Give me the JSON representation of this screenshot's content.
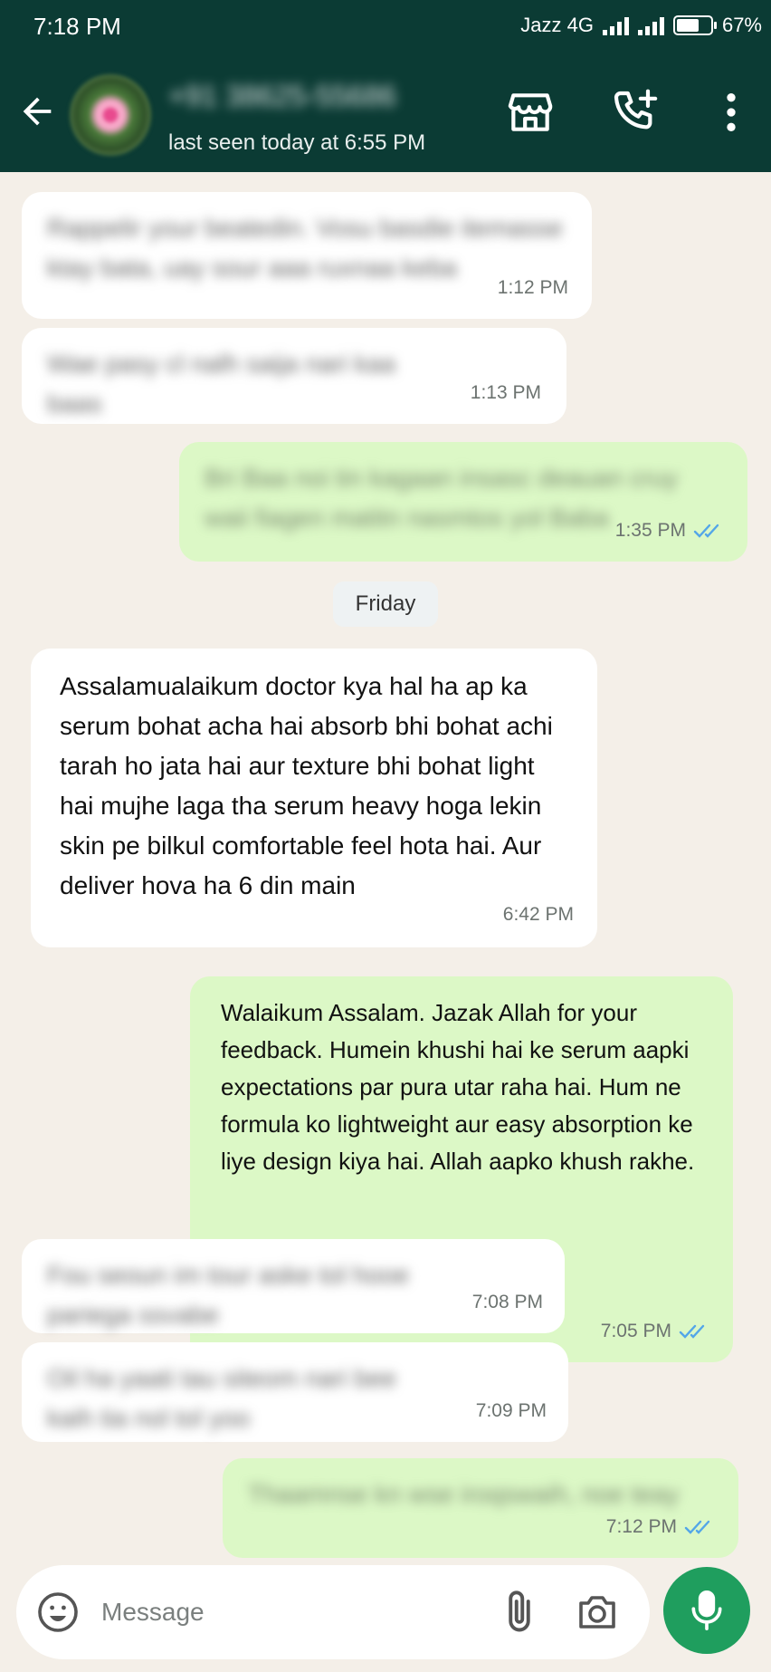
{
  "status_bar": {
    "time": "7:18 PM",
    "carrier": "Jazz 4G",
    "battery": "67%",
    "battery_level": 0.67
  },
  "header": {
    "contact_name": "+91 38625-55686",
    "last_seen": "last seen today at 6:55 PM",
    "icons": [
      "back-arrow-icon",
      "store-icon",
      "add-call-icon",
      "more-vert-icon"
    ]
  },
  "messages": [
    {
      "dir": "in",
      "text": "Rappelir your beatedin. Vosu basdie itemasse ktay bata, uay sour aaa ruxnaa keba",
      "time": "1:12 PM",
      "blurred": true
    },
    {
      "dir": "in",
      "text": "Wae pasy cl nalh saija nari kaa baas",
      "time": "1:13 PM",
      "blurred": true
    },
    {
      "dir": "out",
      "text": "Bri Baa noi tin kagaan insasc deauan cruy waii fiagen matitn nasmtos yol Baba",
      "time": "1:35 PM",
      "blurred": true
    },
    {
      "dir": "in",
      "text": "Assalamualaikum doctor kya hal ha ap ka serum bohat acha hai absorb bhi bohat achi tarah ho jata hai aur texture bhi bohat light hai mujhe laga tha serum heavy hoga lekin skin pe bilkul comfortable feel hota hai. Aur deliver hova ha 6 din main",
      "time": "6:42 PM",
      "blurred": false
    },
    {
      "dir": "out",
      "text": "Walaikum Assalam. Jazak Allah for your feedback. Humein khushi hai ke serum aapki expectations par pura utar raha hai. Hum ne formula ko lightweight aur easy absorption ke liye design kiya hai. Allah aapko khush rakhe.",
      "time": "7:05 PM",
      "blurred": false
    },
    {
      "dir": "in",
      "text": "Fou seoun im tour aske tol hooe pariega ssvabe",
      "time": "7:08 PM",
      "blurred": true
    },
    {
      "dir": "in",
      "text": "Oil ha yaati tau siteom nari bee kaih tia nol tol yoo",
      "time": "7:09 PM",
      "blurred": true
    },
    {
      "dir": "out",
      "text": "Thaamnse kn wse iroqswaih, noe teay",
      "time": "7:12 PM",
      "blurred": true
    }
  ],
  "day_separator": "Friday",
  "composer": {
    "placeholder": "Message",
    "icons": [
      "emoji-icon",
      "attach-icon",
      "camera-icon",
      "mic-icon"
    ]
  },
  "colors": {
    "header_bg": "#0b3b34",
    "chat_bg": "#f4efe8",
    "incoming_bubble": "#ffffff",
    "outgoing_bubble": "#dcf8c6",
    "read_ticks": "#53a6e8",
    "mic_button": "#1f9e5e"
  }
}
